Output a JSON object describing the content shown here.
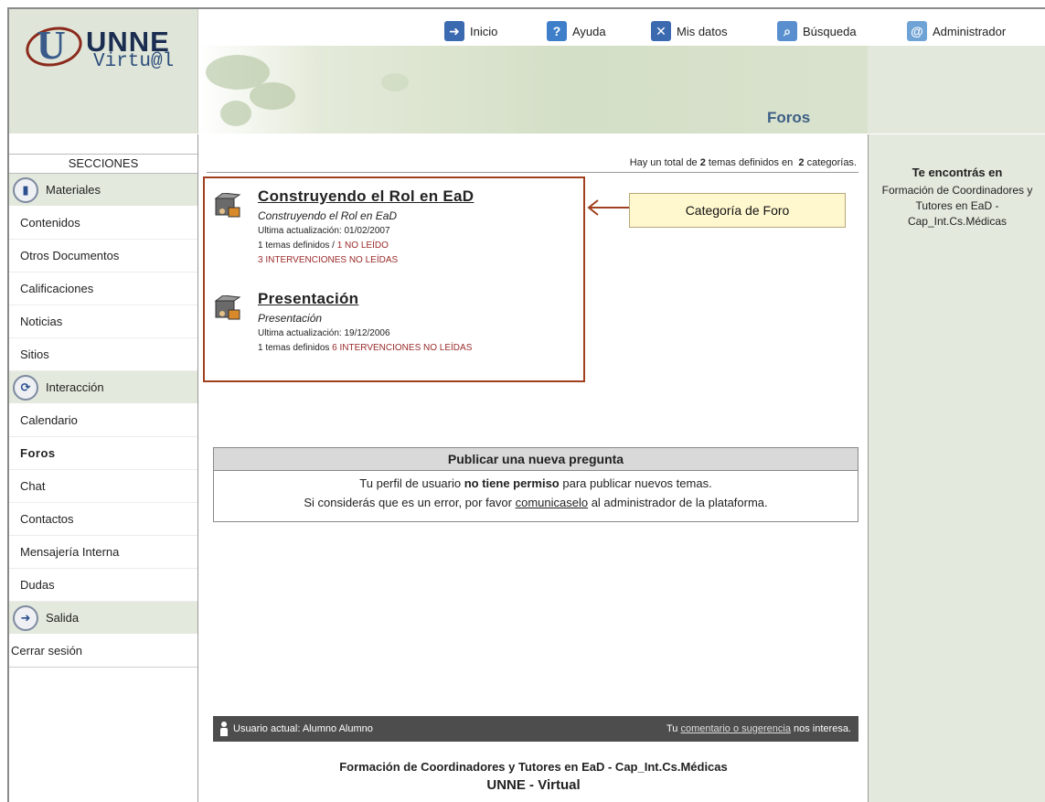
{
  "header": {
    "logo": {
      "line1": "UNNE",
      "line2": "Virtu@l"
    },
    "nav": [
      {
        "label": "Inicio",
        "icon": "arrow-icon"
      },
      {
        "label": "Ayuda",
        "icon": "help-icon"
      },
      {
        "label": "Mis datos",
        "icon": "user-data-icon"
      },
      {
        "label": "Búsqueda",
        "icon": "search-icon"
      },
      {
        "label": "Administrador",
        "icon": "at-icon"
      }
    ],
    "page_title": "Foros"
  },
  "sidebar": {
    "title": "SECCIONES",
    "sections": [
      {
        "label": "Materiales",
        "icon": "book-icon",
        "items": [
          "Contenidos",
          "Otros Documentos",
          "Calificaciones",
          "Noticias",
          "Sitios"
        ]
      },
      {
        "label": "Interacción",
        "icon": "refresh-icon",
        "items": [
          "Calendario",
          "Foros",
          "Chat",
          "Contactos",
          "Mensajería Interna",
          "Dudas"
        ]
      },
      {
        "label": "Salida",
        "icon": "exit-arrow-icon",
        "items": []
      }
    ],
    "active": "Foros",
    "logout": "Cerrar sesión"
  },
  "main": {
    "summary": {
      "prefix": "Hay un total de ",
      "topics": "2",
      "middle": " temas definidos en ",
      "categories": "2",
      "suffix": " categorías."
    },
    "categories": [
      {
        "title": "Construyendo el Rol en EaD",
        "subtitle": "Construyendo el Rol en EaD",
        "last_update": "Ultima actualización: 01/02/2007",
        "topics": "1 temas definidos / ",
        "unread_topics": "1 NO LEÍDO",
        "unread_posts": "3 INTERVENCIONES NO LEÍDAS"
      },
      {
        "title": "Presentación",
        "subtitle": "Presentación",
        "last_update": "Ultima actualización: 19/12/2006",
        "topics": "1 temas definidos ",
        "unread_posts": "6 INTERVENCIONES NO LEÍDAS"
      }
    ],
    "callout": "Categoría de Foro",
    "post_box": {
      "title": "Publicar una nueva pregunta",
      "line1_pre": "Tu perfil de usuario ",
      "line1_bold": "no tiene permiso",
      "line1_post": " para publicar nuevos temas.",
      "line2_pre": "Si considerás que es un error, por favor ",
      "line2_link": "comunicaselo",
      "line2_post": " al administrador de la plataforma."
    },
    "userbar": {
      "user": "Usuario actual:  Alumno Alumno",
      "comment_pre": "Tu ",
      "comment_link": "comentario o sugerencia",
      "comment_post": " nos interesa."
    },
    "footer_line1": "Formación de Coordinadores y Tutores en EaD - Cap_Int.Cs.Médicas",
    "footer_line2": "UNNE - Virtual"
  },
  "right_panel": {
    "title": "Te encontrás en",
    "body": "Formación de Coordinadores y Tutores en EaD - Cap_Int.Cs.Médicas"
  },
  "colors": {
    "accent_red": "#9b2a2a",
    "box_border": "#a0401f",
    "panel_green": "#e3e9dd",
    "title_blue": "#3d5f86"
  }
}
